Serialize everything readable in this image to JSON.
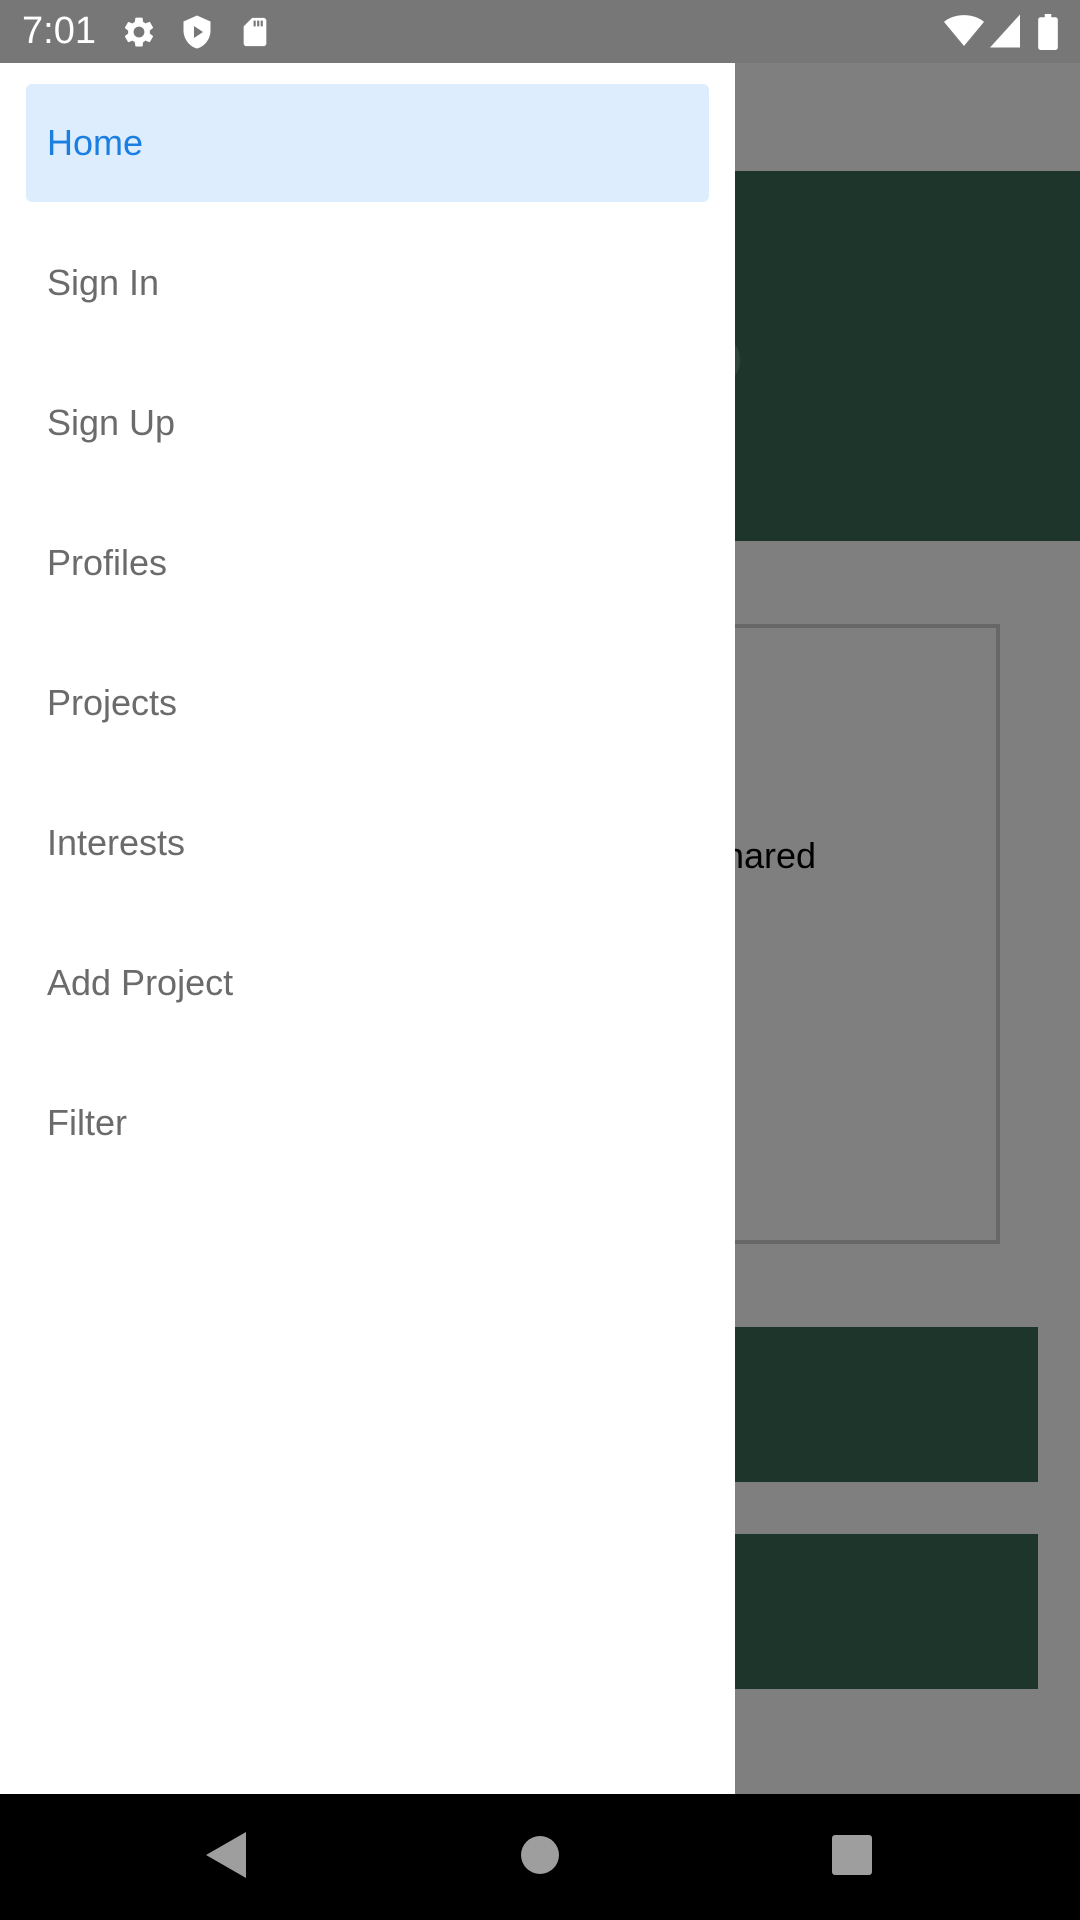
{
  "status_bar": {
    "time": "7:01",
    "icons_left": [
      "settings-icon",
      "shield-play-icon",
      "sd-card-icon"
    ],
    "icons_right": [
      "wifi-icon",
      "cell-signal-icon",
      "battery-icon"
    ]
  },
  "background_app": {
    "card_text": "shared",
    "accent_color": "#3a6b57"
  },
  "drawer": {
    "active_color": "#1a7fe0",
    "active_background": "#ddedfd",
    "items": [
      {
        "label": "Home",
        "active": true
      },
      {
        "label": "Sign In",
        "active": false
      },
      {
        "label": "Sign Up",
        "active": false
      },
      {
        "label": "Profiles",
        "active": false
      },
      {
        "label": "Projects",
        "active": false
      },
      {
        "label": "Interests",
        "active": false
      },
      {
        "label": "Add Project",
        "active": false
      },
      {
        "label": "Filter",
        "active": false
      }
    ]
  },
  "nav_bar": {
    "buttons": [
      "back-icon",
      "home-icon",
      "recents-icon"
    ]
  }
}
